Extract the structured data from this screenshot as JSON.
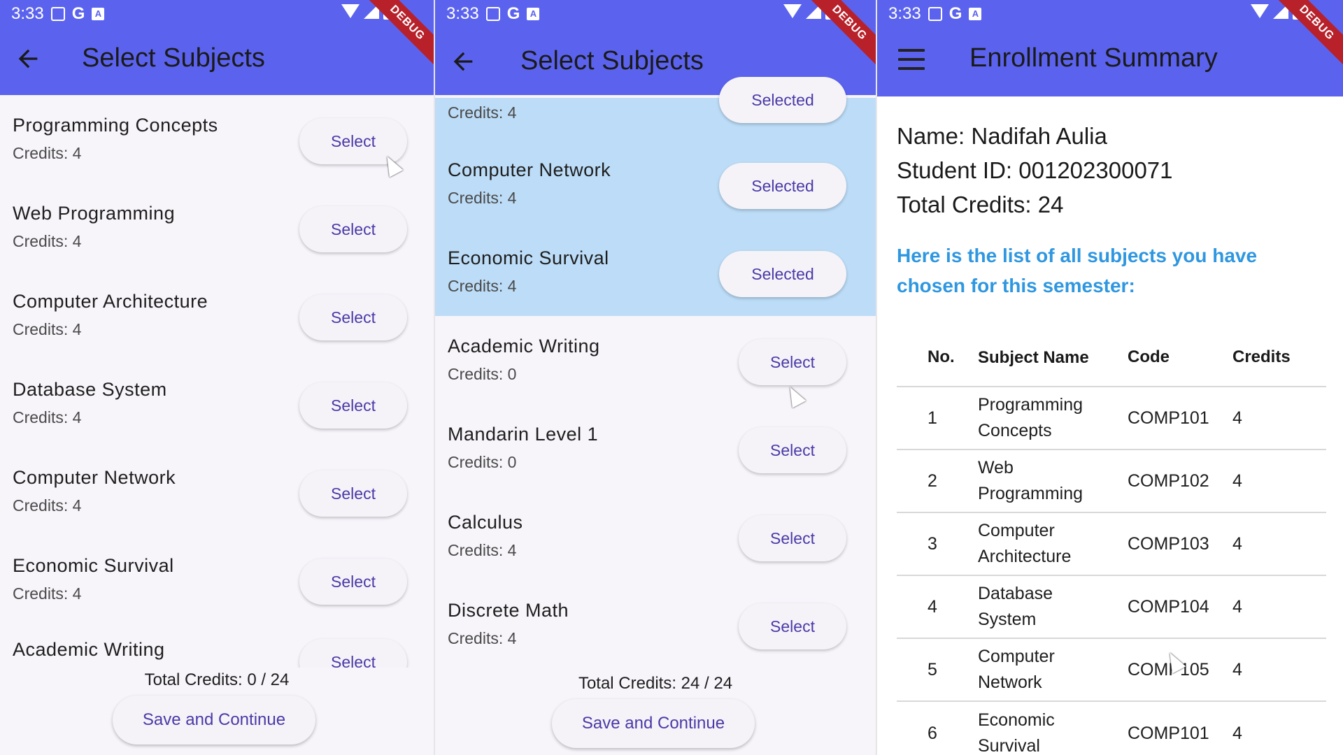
{
  "status": {
    "time": "3:33",
    "g_label": "G",
    "a_label": "A",
    "debug_banner": "DEBUG"
  },
  "colors": {
    "appbar": "#5b63ee",
    "selected_row": "#bcdcf7",
    "button_text": "#4b3aa8",
    "info_text": "#2f97e0",
    "debug_banner": "#b8202a"
  },
  "screen1": {
    "title": "Select Subjects",
    "subjects": [
      {
        "name": "Programming Concepts",
        "credits": "Credits: 4",
        "button": "Select"
      },
      {
        "name": "Web Programming",
        "credits": "Credits: 4",
        "button": "Select"
      },
      {
        "name": "Computer Architecture",
        "credits": "Credits: 4",
        "button": "Select"
      },
      {
        "name": "Database System",
        "credits": "Credits: 4",
        "button": "Select"
      },
      {
        "name": "Computer Network",
        "credits": "Credits: 4",
        "button": "Select"
      },
      {
        "name": "Economic Survival",
        "credits": "Credits: 4",
        "button": "Select"
      },
      {
        "name": "Academic Writing",
        "credits": "",
        "button": "Select"
      }
    ],
    "total": "Total Credits: 0 / 24",
    "save": "Save and Continue"
  },
  "screen2": {
    "title": "Select Subjects",
    "subjects": [
      {
        "name": "",
        "credits": "Credits: 4",
        "button": "Selected",
        "selected": true
      },
      {
        "name": "Computer Network",
        "credits": "Credits: 4",
        "button": "Selected",
        "selected": true
      },
      {
        "name": "Economic Survival",
        "credits": "Credits: 4",
        "button": "Selected",
        "selected": true
      },
      {
        "name": "Academic Writing",
        "credits": "Credits: 0",
        "button": "Select",
        "selected": false
      },
      {
        "name": "Mandarin Level 1",
        "credits": "Credits: 0",
        "button": "Select",
        "selected": false
      },
      {
        "name": "Calculus",
        "credits": "Credits: 4",
        "button": "Select",
        "selected": false
      },
      {
        "name": "Discrete Math",
        "credits": "Credits: 4",
        "button": "Select",
        "selected": false
      }
    ],
    "total": "Total Credits: 24 / 24",
    "save": "Save and Continue"
  },
  "screen3": {
    "title": "Enrollment Summary",
    "name_line": "Name: Nadifah Aulia",
    "id_line": "Student ID: 001202300071",
    "credits_line": "Total Credits: 24",
    "note": "Here is the list of all subjects you have chosen for this semester:",
    "table": {
      "headers": [
        "No.",
        "Subject Name",
        "Code",
        "Credits"
      ],
      "rows": [
        [
          "1",
          "Programming Concepts",
          "COMP101",
          "4"
        ],
        [
          "2",
          "Web Programming",
          "COMP102",
          "4"
        ],
        [
          "3",
          "Computer Architecture",
          "COMP103",
          "4"
        ],
        [
          "4",
          "Database System",
          "COMP104",
          "4"
        ],
        [
          "5",
          "Computer Network",
          "COMP105",
          "4"
        ],
        [
          "6",
          "Economic Survival",
          "COMP101",
          "4"
        ]
      ]
    }
  }
}
